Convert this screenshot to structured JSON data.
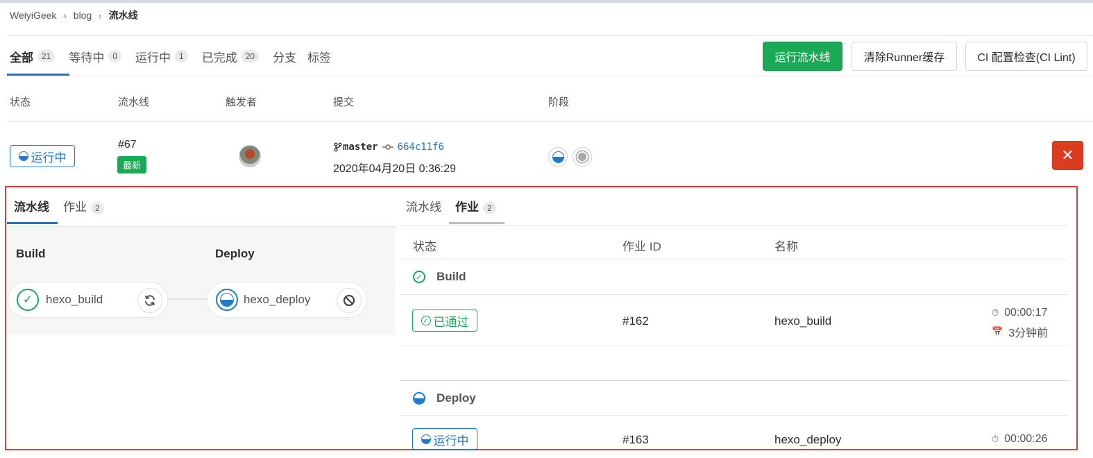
{
  "breadcrumb": [
    "WeiyiGeek",
    "blog",
    "流水线"
  ],
  "tabs": [
    {
      "label": "全部",
      "count": "21"
    },
    {
      "label": "等待中",
      "count": "0"
    },
    {
      "label": "运行中",
      "count": "1"
    },
    {
      "label": "已完成",
      "count": "20"
    },
    {
      "label": "分支",
      "count": ""
    },
    {
      "label": "标签",
      "count": ""
    }
  ],
  "actions": {
    "run": "运行流水线",
    "clear": "清除Runner缓存",
    "lint": "CI 配置检查(CI Lint)"
  },
  "table_headers": {
    "status": "状态",
    "pipeline": "流水线",
    "trigger": "触发者",
    "commit": "提交",
    "stages": "阶段"
  },
  "pipeline_row": {
    "status": "运行中",
    "id": "#67",
    "latest": "最新",
    "branch": "master",
    "sha": "664c11f6",
    "time": "2020年04月20日 0:36:29",
    "cancel_icon": "✕"
  },
  "left_panel": {
    "tabs": {
      "pipeline": "流水线",
      "jobs": "作业",
      "jobs_count": "2"
    },
    "stages": [
      {
        "title": "Build",
        "job": "hexo_build",
        "status_icon": "check-icon",
        "action_icon": "retry-icon"
      },
      {
        "title": "Deploy",
        "job": "hexo_deploy",
        "status_icon": "running-icon",
        "action_icon": "cancel-icon"
      }
    ]
  },
  "right_panel": {
    "tabs": {
      "pipeline": "流水线",
      "jobs": "作业",
      "jobs_count": "2"
    },
    "headers": {
      "status": "状态",
      "job_id": "作业 ID",
      "name": "名称"
    },
    "groups": [
      {
        "title": "Build",
        "status": "已通过",
        "job_id": "#162",
        "name": "hexo_build",
        "duration": "00:00:17",
        "ago": "3分钟前"
      },
      {
        "title": "Deploy",
        "status": "运行中",
        "job_id": "#163",
        "name": "hexo_deploy",
        "duration": "00:00:26"
      }
    ]
  },
  "colors": {
    "success": "#1aaa55",
    "running": "#1f78d1",
    "danger": "#db3b21",
    "highlight": "#e0393e"
  }
}
